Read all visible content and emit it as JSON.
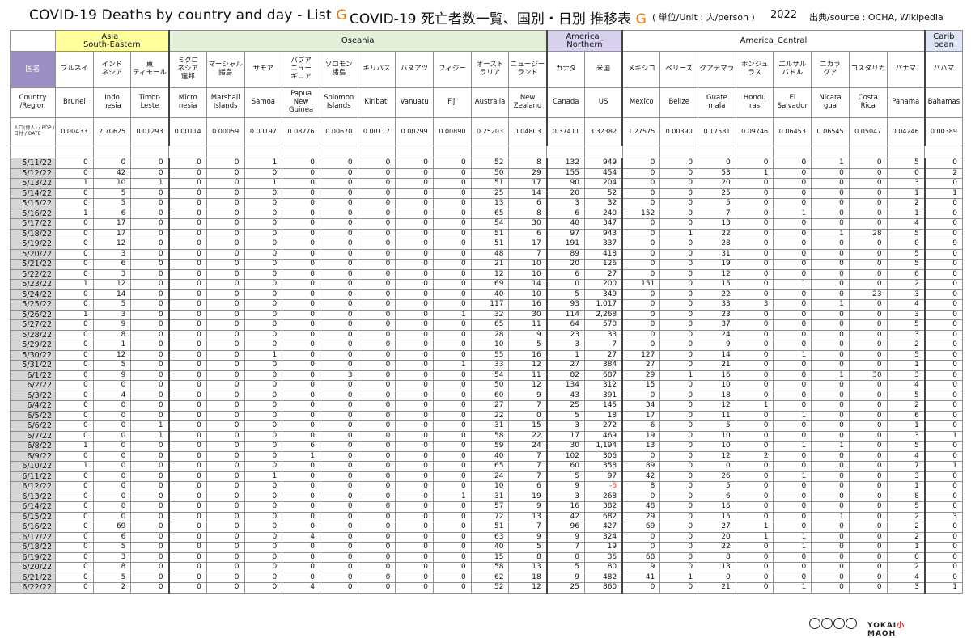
{
  "header": {
    "title_en_prefix": "COVID-19 Deaths by country and day - List ",
    "title_jp_prefix": "COVID-19 死亡者数一覧、国別・日別 推移表 ",
    "list_letter": "G",
    "unit": "( 単位/Unit : 人/person )",
    "year": "2022",
    "source": "出典/source : OCHA, Wikipedia"
  },
  "regions": [
    {
      "name": "Asia_\nSouth-Eastern",
      "span": 3,
      "cls": "r-asia"
    },
    {
      "name": "Oseania",
      "span": 10,
      "cls": "r-oce"
    },
    {
      "name": "America_\nNorthern",
      "span": 2,
      "cls": "r-amn"
    },
    {
      "name": "America_Central",
      "span": 8,
      "cls": "r-amc"
    },
    {
      "name": "Carib\nbean",
      "span": 1,
      "cls": "r-car"
    }
  ],
  "labels": {
    "jp_header": "国名",
    "en_header": "Country\n/Region",
    "pop_header": "人口(億人) / POP / 日付 / DATE"
  },
  "countries": [
    {
      "jp": "ブルネイ",
      "en": "Brunei",
      "pop": "0.00433"
    },
    {
      "jp": "インド\nネシア",
      "en": "Indo\nnesia",
      "pop": "2.70625"
    },
    {
      "jp": "東\nティモール",
      "en": "Timor-\nLeste",
      "pop": "0.01293"
    },
    {
      "jp": "ミクロ\nネシア\n連邦",
      "en": "Micro\nnesia",
      "pop": "0.00114"
    },
    {
      "jp": "マーシャル\n諸島",
      "en": "Marshall\nIslands",
      "pop": "0.00059"
    },
    {
      "jp": "サモア",
      "en": "Samoa",
      "pop": "0.00197"
    },
    {
      "jp": "パプア\nニュー\nギニア",
      "en": "Papua\nNew\nGuinea",
      "pop": "0.08776"
    },
    {
      "jp": "ソロモン\n諸島",
      "en": "Solomon\nIslands",
      "pop": "0.00670"
    },
    {
      "jp": "キリバス",
      "en": "Kiribati",
      "pop": "0.00117"
    },
    {
      "jp": "バヌアツ",
      "en": "Vanuatu",
      "pop": "0.00299"
    },
    {
      "jp": "フィジー",
      "en": "Fiji",
      "pop": "0.00890"
    },
    {
      "jp": "オースト\nラリア",
      "en": "Australia",
      "pop": "0.25203"
    },
    {
      "jp": "ニュージー\nランド",
      "en": "New\nZealand",
      "pop": "0.04803"
    },
    {
      "jp": "カナダ",
      "en": "Canada",
      "pop": "0.37411"
    },
    {
      "jp": "米国",
      "en": "US",
      "pop": "3.32382"
    },
    {
      "jp": "メキシコ",
      "en": "Mexico",
      "pop": "1.27575"
    },
    {
      "jp": "ベリーズ",
      "en": "Belize",
      "pop": "0.00390"
    },
    {
      "jp": "グアテマラ",
      "en": "Guate\nmala",
      "pop": "0.17581"
    },
    {
      "jp": "ホンジュ\nラス",
      "en": "Hondu\nras",
      "pop": "0.09746"
    },
    {
      "jp": "エルサル\nバドル",
      "en": "El\nSalvador",
      "pop": "0.06453"
    },
    {
      "jp": "ニカラ\nグア",
      "en": "Nicara\ngua",
      "pop": "0.06545"
    },
    {
      "jp": "コスタリカ",
      "en": "Costa\nRica",
      "pop": "0.05047"
    },
    {
      "jp": "パナマ",
      "en": "Panama",
      "pop": "0.04246"
    },
    {
      "jp": "バハマ",
      "en": "Bahamas",
      "pop": "0.00389"
    }
  ],
  "rows": [
    {
      "date": "5/11/22",
      "v": [
        "0",
        "0",
        "0",
        "0",
        "0",
        "1",
        "0",
        "0",
        "0",
        "0",
        "0",
        "52",
        "8",
        "132",
        "949",
        "0",
        "0",
        "0",
        "0",
        "0",
        "1",
        "0",
        "5",
        "0"
      ]
    },
    {
      "date": "5/12/22",
      "v": [
        "0",
        "42",
        "0",
        "0",
        "0",
        "0",
        "0",
        "0",
        "0",
        "0",
        "0",
        "50",
        "29",
        "155",
        "454",
        "0",
        "0",
        "53",
        "1",
        "0",
        "0",
        "0",
        "0",
        "2"
      ]
    },
    {
      "date": "5/13/22",
      "v": [
        "1",
        "10",
        "1",
        "0",
        "0",
        "1",
        "0",
        "0",
        "0",
        "0",
        "0",
        "51",
        "17",
        "90",
        "204",
        "0",
        "0",
        "20",
        "0",
        "0",
        "0",
        "0",
        "3",
        "0"
      ]
    },
    {
      "date": "5/14/22",
      "v": [
        "0",
        "5",
        "0",
        "0",
        "0",
        "0",
        "0",
        "0",
        "0",
        "0",
        "0",
        "25",
        "14",
        "20",
        "52",
        "0",
        "0",
        "25",
        "0",
        "0",
        "0",
        "0",
        "1",
        "1"
      ]
    },
    {
      "date": "5/15/22",
      "v": [
        "0",
        "5",
        "0",
        "0",
        "0",
        "0",
        "0",
        "0",
        "0",
        "0",
        "0",
        "13",
        "6",
        "3",
        "32",
        "0",
        "0",
        "5",
        "0",
        "0",
        "0",
        "0",
        "2",
        "0"
      ]
    },
    {
      "date": "5/16/22",
      "v": [
        "1",
        "6",
        "0",
        "0",
        "0",
        "0",
        "0",
        "0",
        "0",
        "0",
        "0",
        "65",
        "8",
        "6",
        "240",
        "152",
        "0",
        "7",
        "0",
        "1",
        "0",
        "0",
        "1",
        "0"
      ]
    },
    {
      "date": "5/17/22",
      "v": [
        "0",
        "17",
        "0",
        "0",
        "0",
        "0",
        "0",
        "0",
        "0",
        "0",
        "0",
        "54",
        "30",
        "40",
        "347",
        "0",
        "0",
        "13",
        "0",
        "0",
        "0",
        "0",
        "4",
        "0"
      ]
    },
    {
      "date": "5/18/22",
      "v": [
        "0",
        "17",
        "0",
        "0",
        "0",
        "0",
        "0",
        "0",
        "0",
        "0",
        "0",
        "51",
        "6",
        "97",
        "943",
        "0",
        "1",
        "22",
        "0",
        "0",
        "1",
        "28",
        "5",
        "0"
      ]
    },
    {
      "date": "5/19/22",
      "v": [
        "0",
        "12",
        "0",
        "0",
        "0",
        "0",
        "0",
        "0",
        "0",
        "0",
        "0",
        "51",
        "17",
        "191",
        "337",
        "0",
        "0",
        "28",
        "0",
        "0",
        "0",
        "0",
        "0",
        "9"
      ]
    },
    {
      "date": "5/20/22",
      "v": [
        "0",
        "3",
        "0",
        "0",
        "0",
        "0",
        "0",
        "0",
        "0",
        "0",
        "0",
        "48",
        "7",
        "89",
        "418",
        "0",
        "0",
        "31",
        "0",
        "0",
        "0",
        "0",
        "5",
        "0"
      ]
    },
    {
      "date": "5/21/22",
      "v": [
        "0",
        "6",
        "0",
        "0",
        "0",
        "0",
        "0",
        "0",
        "0",
        "0",
        "0",
        "21",
        "10",
        "20",
        "126",
        "0",
        "0",
        "19",
        "0",
        "0",
        "0",
        "0",
        "5",
        "0"
      ]
    },
    {
      "date": "5/22/22",
      "v": [
        "0",
        "3",
        "0",
        "0",
        "0",
        "0",
        "0",
        "0",
        "0",
        "0",
        "0",
        "12",
        "10",
        "6",
        "27",
        "0",
        "0",
        "12",
        "0",
        "0",
        "0",
        "0",
        "6",
        "0"
      ]
    },
    {
      "date": "5/23/22",
      "v": [
        "1",
        "12",
        "0",
        "0",
        "0",
        "0",
        "0",
        "0",
        "0",
        "0",
        "0",
        "69",
        "14",
        "0",
        "200",
        "151",
        "0",
        "15",
        "0",
        "1",
        "0",
        "0",
        "2",
        "0"
      ]
    },
    {
      "date": "5/24/22",
      "v": [
        "0",
        "14",
        "0",
        "0",
        "0",
        "0",
        "0",
        "0",
        "0",
        "0",
        "0",
        "40",
        "10",
        "5",
        "349",
        "0",
        "0",
        "22",
        "0",
        "0",
        "0",
        "23",
        "3",
        "0"
      ]
    },
    {
      "date": "5/25/22",
      "v": [
        "0",
        "5",
        "0",
        "0",
        "0",
        "0",
        "0",
        "0",
        "0",
        "0",
        "0",
        "117",
        "16",
        "93",
        "1,017",
        "0",
        "0",
        "33",
        "3",
        "0",
        "1",
        "0",
        "4",
        "0"
      ]
    },
    {
      "date": "5/26/22",
      "v": [
        "1",
        "3",
        "0",
        "0",
        "0",
        "0",
        "0",
        "0",
        "0",
        "0",
        "1",
        "32",
        "30",
        "114",
        "2,268",
        "0",
        "0",
        "23",
        "0",
        "0",
        "0",
        "0",
        "3",
        "0"
      ]
    },
    {
      "date": "5/27/22",
      "v": [
        "0",
        "9",
        "0",
        "0",
        "0",
        "0",
        "0",
        "0",
        "0",
        "0",
        "0",
        "65",
        "11",
        "64",
        "570",
        "0",
        "0",
        "37",
        "0",
        "0",
        "0",
        "0",
        "5",
        "0"
      ]
    },
    {
      "date": "5/28/22",
      "v": [
        "0",
        "8",
        "0",
        "0",
        "0",
        "0",
        "0",
        "0",
        "0",
        "0",
        "0",
        "28",
        "9",
        "23",
        "33",
        "0",
        "0",
        "24",
        "0",
        "0",
        "0",
        "0",
        "3",
        "0"
      ]
    },
    {
      "date": "5/29/22",
      "v": [
        "0",
        "1",
        "0",
        "0",
        "0",
        "0",
        "0",
        "0",
        "0",
        "0",
        "0",
        "10",
        "5",
        "3",
        "7",
        "0",
        "0",
        "9",
        "0",
        "0",
        "0",
        "0",
        "2",
        "0"
      ]
    },
    {
      "date": "5/30/22",
      "v": [
        "0",
        "12",
        "0",
        "0",
        "0",
        "1",
        "0",
        "0",
        "0",
        "0",
        "0",
        "55",
        "16",
        "1",
        "27",
        "127",
        "0",
        "14",
        "0",
        "1",
        "0",
        "0",
        "5",
        "0"
      ]
    },
    {
      "date": "5/31/22",
      "v": [
        "0",
        "5",
        "0",
        "0",
        "0",
        "0",
        "0",
        "0",
        "0",
        "0",
        "1",
        "33",
        "12",
        "27",
        "384",
        "27",
        "0",
        "21",
        "0",
        "0",
        "0",
        "0",
        "1",
        "0"
      ]
    },
    {
      "date": "6/1/22",
      "v": [
        "0",
        "9",
        "0",
        "0",
        "0",
        "0",
        "0",
        "3",
        "0",
        "0",
        "0",
        "54",
        "11",
        "82",
        "687",
        "29",
        "1",
        "16",
        "0",
        "0",
        "1",
        "30",
        "3",
        "0"
      ]
    },
    {
      "date": "6/2/22",
      "v": [
        "0",
        "0",
        "0",
        "0",
        "0",
        "0",
        "0",
        "0",
        "0",
        "0",
        "0",
        "50",
        "12",
        "134",
        "312",
        "15",
        "0",
        "10",
        "0",
        "0",
        "0",
        "0",
        "4",
        "0"
      ]
    },
    {
      "date": "6/3/22",
      "v": [
        "0",
        "4",
        "0",
        "0",
        "0",
        "0",
        "0",
        "0",
        "0",
        "0",
        "0",
        "60",
        "9",
        "43",
        "391",
        "0",
        "0",
        "18",
        "0",
        "0",
        "0",
        "0",
        "5",
        "0"
      ]
    },
    {
      "date": "6/4/22",
      "v": [
        "0",
        "0",
        "0",
        "0",
        "0",
        "0",
        "0",
        "0",
        "0",
        "0",
        "0",
        "27",
        "7",
        "25",
        "145",
        "34",
        "0",
        "12",
        "1",
        "0",
        "0",
        "0",
        "2",
        "0"
      ]
    },
    {
      "date": "6/5/22",
      "v": [
        "0",
        "0",
        "0",
        "0",
        "0",
        "0",
        "0",
        "0",
        "0",
        "0",
        "0",
        "22",
        "0",
        "5",
        "18",
        "17",
        "0",
        "11",
        "0",
        "1",
        "0",
        "0",
        "6",
        "0"
      ]
    },
    {
      "date": "6/6/22",
      "v": [
        "0",
        "0",
        "1",
        "0",
        "0",
        "0",
        "0",
        "0",
        "0",
        "0",
        "0",
        "31",
        "15",
        "3",
        "272",
        "6",
        "0",
        "5",
        "0",
        "0",
        "0",
        "0",
        "1",
        "0"
      ]
    },
    {
      "date": "6/7/22",
      "v": [
        "0",
        "0",
        "1",
        "0",
        "0",
        "0",
        "0",
        "0",
        "0",
        "0",
        "0",
        "58",
        "22",
        "17",
        "469",
        "19",
        "0",
        "10",
        "0",
        "0",
        "0",
        "0",
        "3",
        "1"
      ]
    },
    {
      "date": "6/8/22",
      "v": [
        "1",
        "0",
        "0",
        "0",
        "0",
        "0",
        "6",
        "0",
        "0",
        "0",
        "0",
        "59",
        "24",
        "30",
        "1,194",
        "13",
        "0",
        "10",
        "0",
        "1",
        "1",
        "0",
        "5",
        "0"
      ]
    },
    {
      "date": "6/9/22",
      "v": [
        "0",
        "0",
        "0",
        "0",
        "0",
        "0",
        "1",
        "0",
        "0",
        "0",
        "0",
        "40",
        "7",
        "102",
        "306",
        "0",
        "0",
        "12",
        "2",
        "0",
        "0",
        "0",
        "4",
        "0"
      ]
    },
    {
      "date": "6/10/22",
      "v": [
        "1",
        "0",
        "0",
        "0",
        "0",
        "0",
        "0",
        "0",
        "0",
        "0",
        "0",
        "65",
        "7",
        "60",
        "358",
        "89",
        "0",
        "0",
        "0",
        "0",
        "0",
        "0",
        "7",
        "1"
      ]
    },
    {
      "date": "6/11/22",
      "v": [
        "0",
        "0",
        "0",
        "0",
        "0",
        "1",
        "0",
        "0",
        "0",
        "0",
        "0",
        "24",
        "7",
        "5",
        "97",
        "42",
        "0",
        "26",
        "0",
        "1",
        "0",
        "0",
        "3",
        "0"
      ]
    },
    {
      "date": "6/12/22",
      "v": [
        "0",
        "0",
        "0",
        "0",
        "0",
        "0",
        "0",
        "0",
        "0",
        "0",
        "0",
        "10",
        "6",
        "9",
        "-6",
        "8",
        "0",
        "5",
        "0",
        "0",
        "0",
        "0",
        "1",
        "0"
      ]
    },
    {
      "date": "6/13/22",
      "v": [
        "0",
        "0",
        "0",
        "0",
        "0",
        "0",
        "0",
        "0",
        "0",
        "0",
        "1",
        "31",
        "19",
        "3",
        "268",
        "0",
        "0",
        "6",
        "0",
        "0",
        "0",
        "0",
        "8",
        "0"
      ]
    },
    {
      "date": "6/14/22",
      "v": [
        "0",
        "0",
        "0",
        "0",
        "0",
        "0",
        "0",
        "0",
        "0",
        "0",
        "0",
        "57",
        "9",
        "16",
        "382",
        "48",
        "0",
        "16",
        "0",
        "0",
        "0",
        "0",
        "5",
        "0"
      ]
    },
    {
      "date": "6/15/22",
      "v": [
        "0",
        "0",
        "0",
        "0",
        "0",
        "0",
        "0",
        "0",
        "0",
        "0",
        "0",
        "72",
        "13",
        "42",
        "682",
        "29",
        "0",
        "15",
        "0",
        "0",
        "1",
        "0",
        "2",
        "3"
      ]
    },
    {
      "date": "6/16/22",
      "v": [
        "0",
        "69",
        "0",
        "0",
        "0",
        "0",
        "0",
        "0",
        "0",
        "0",
        "0",
        "51",
        "7",
        "96",
        "427",
        "69",
        "0",
        "27",
        "1",
        "0",
        "0",
        "0",
        "2",
        "0"
      ]
    },
    {
      "date": "6/17/22",
      "v": [
        "0",
        "6",
        "0",
        "0",
        "0",
        "0",
        "4",
        "0",
        "0",
        "0",
        "0",
        "63",
        "9",
        "9",
        "324",
        "0",
        "0",
        "20",
        "1",
        "1",
        "0",
        "0",
        "2",
        "0"
      ]
    },
    {
      "date": "6/18/22",
      "v": [
        "0",
        "5",
        "0",
        "0",
        "0",
        "0",
        "0",
        "0",
        "0",
        "0",
        "0",
        "40",
        "5",
        "7",
        "19",
        "0",
        "0",
        "22",
        "0",
        "1",
        "0",
        "0",
        "1",
        "0"
      ]
    },
    {
      "date": "6/19/22",
      "v": [
        "0",
        "3",
        "0",
        "0",
        "0",
        "0",
        "0",
        "0",
        "0",
        "0",
        "0",
        "15",
        "8",
        "0",
        "36",
        "68",
        "0",
        "8",
        "0",
        "0",
        "0",
        "0",
        "0",
        "0"
      ]
    },
    {
      "date": "6/20/22",
      "v": [
        "0",
        "8",
        "0",
        "0",
        "0",
        "0",
        "0",
        "0",
        "0",
        "0",
        "0",
        "58",
        "13",
        "5",
        "80",
        "9",
        "0",
        "13",
        "0",
        "0",
        "0",
        "0",
        "2",
        "0"
      ]
    },
    {
      "date": "6/21/22",
      "v": [
        "0",
        "5",
        "0",
        "0",
        "0",
        "0",
        "0",
        "0",
        "0",
        "0",
        "0",
        "62",
        "18",
        "9",
        "482",
        "41",
        "1",
        "0",
        "0",
        "0",
        "0",
        "0",
        "4",
        "0"
      ]
    },
    {
      "date": "6/22/22",
      "v": [
        "0",
        "2",
        "0",
        "0",
        "0",
        "0",
        "4",
        "0",
        "0",
        "0",
        "0",
        "52",
        "12",
        "25",
        "860",
        "0",
        "0",
        "21",
        "0",
        "1",
        "0",
        "0",
        "3",
        "1"
      ]
    }
  ],
  "footer": {
    "license_icons": [
      "cc",
      "by",
      "nc",
      "sa"
    ],
    "logo_text": "YOKAI",
    "logo_mark": "小",
    "logo_text2": "MAOH"
  }
}
